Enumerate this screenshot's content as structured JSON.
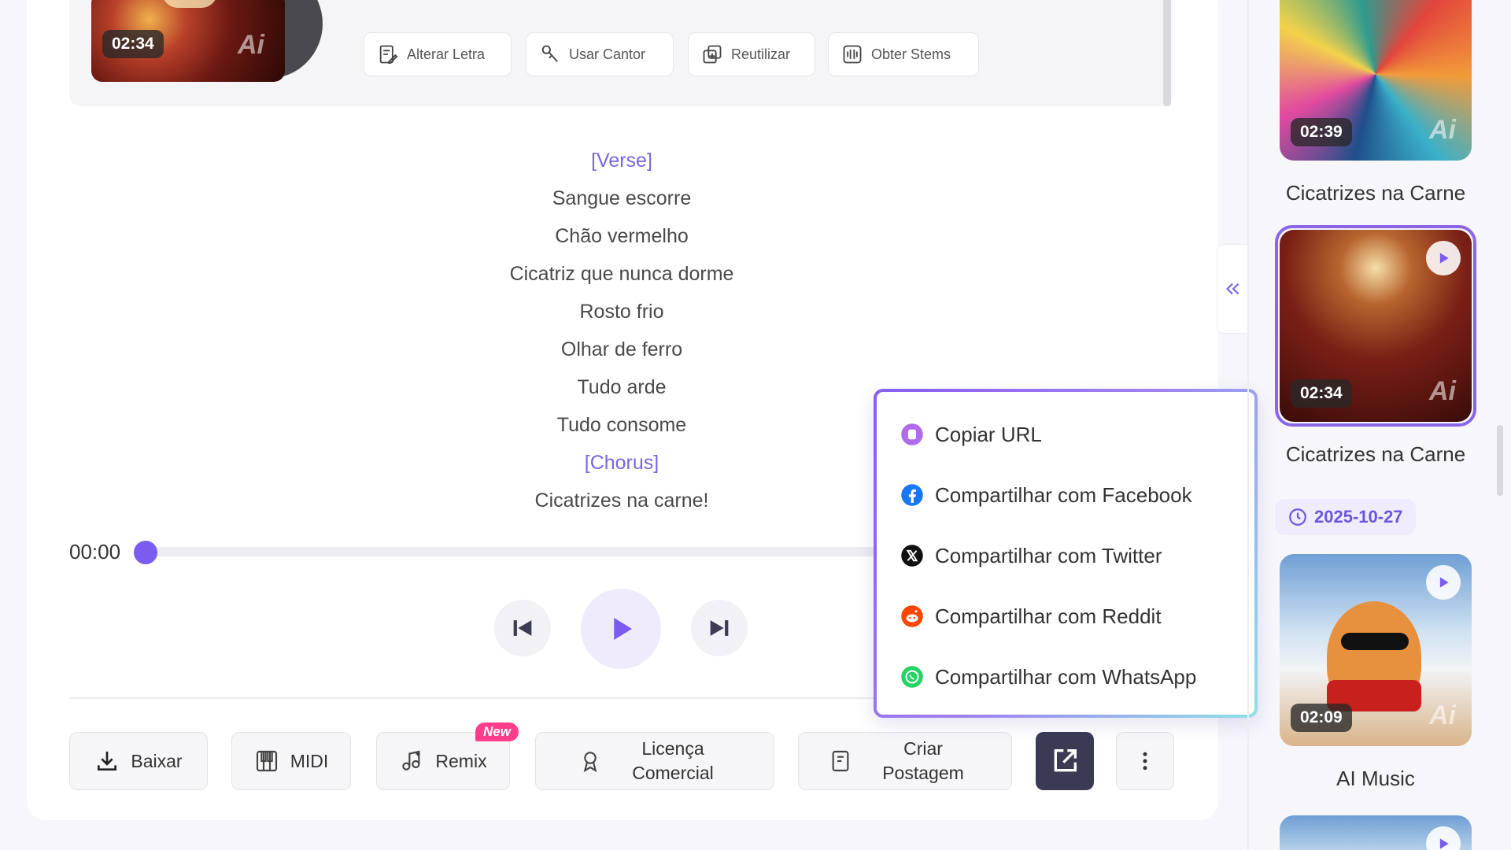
{
  "player": {
    "cover_duration": "02:34",
    "cover_ai_mark": "Ai",
    "tools": {
      "alter_lyrics": "Alterar Letra",
      "use_singer": "Usar Cantor",
      "reuse": "Reutilizar",
      "get_stems": "Obter Stems"
    }
  },
  "lyrics": [
    "[Verse]",
    "Sangue escorre",
    "Chão vermelho",
    "Cicatriz que nunca dorme",
    "Rosto frio",
    "Olhar de ferro",
    "Tudo arde",
    "Tudo consome",
    "[Chorus]",
    "Cicatrizes na carne!"
  ],
  "progress": {
    "current_time": "00:00",
    "fraction": 0.0
  },
  "actions": {
    "download": "Baixar",
    "midi": "MIDI",
    "remix": "Remix",
    "remix_badge": "New",
    "license_line1": "Licença",
    "license_line2": "Comercial",
    "post_line1": "Criar",
    "post_line2": "Postagem"
  },
  "share_menu": {
    "copy_url": "Copiar URL",
    "facebook": "Compartilhar com Facebook",
    "twitter": "Compartilhar com Twitter",
    "reddit": "Compartilhar com Reddit",
    "whatsapp": "Compartilhar com WhatsApp"
  },
  "sidebar": {
    "items": [
      {
        "title": "Cicatrizes na Carne",
        "duration": "02:39"
      },
      {
        "title": "Cicatrizes na Carne",
        "duration": "02:34"
      },
      {
        "title": "AI Music",
        "duration": "02:09"
      }
    ],
    "date": "2025-10-27",
    "ai_mark": "Ai"
  },
  "colors": {
    "accent": "#7a5cf0",
    "facebook": "#1877f2",
    "reddit": "#ff4500",
    "whatsapp": "#25d366",
    "copy": "#b06ce8"
  }
}
